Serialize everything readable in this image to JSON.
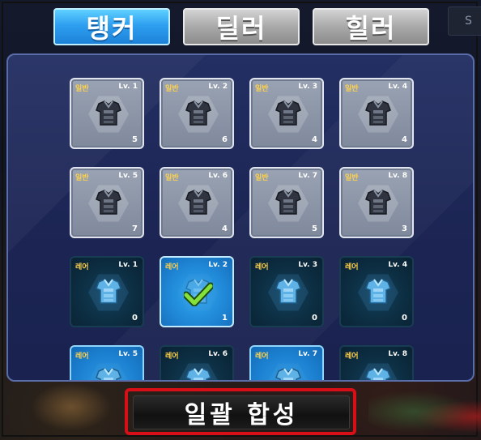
{
  "tabs": [
    {
      "label": "탱커",
      "active": true
    },
    {
      "label": "딜러",
      "active": false
    },
    {
      "label": "힐러",
      "active": false
    }
  ],
  "corner_label": "S",
  "colors": {
    "active_tab": "#2e9ff0",
    "inactive_tab": "#a9a9a9",
    "grade_text": "#ffd24a",
    "highlight_border": "#d80f16"
  },
  "cards": [
    {
      "grade": "일반",
      "level": "Lv. 1",
      "count": "5",
      "rarity": "common",
      "icon": "armor-icon"
    },
    {
      "grade": "일반",
      "level": "Lv. 2",
      "count": "6",
      "rarity": "common",
      "icon": "armor-icon"
    },
    {
      "grade": "일반",
      "level": "Lv. 3",
      "count": "4",
      "rarity": "common",
      "icon": "armor-icon"
    },
    {
      "grade": "일반",
      "level": "Lv. 4",
      "count": "4",
      "rarity": "common",
      "icon": "armor-icon"
    },
    {
      "grade": "일반",
      "level": "Lv. 5",
      "count": "7",
      "rarity": "common",
      "icon": "armor-icon"
    },
    {
      "grade": "일반",
      "level": "Lv. 6",
      "count": "4",
      "rarity": "common",
      "icon": "armor-icon"
    },
    {
      "grade": "일반",
      "level": "Lv. 7",
      "count": "5",
      "rarity": "common",
      "icon": "armor-icon"
    },
    {
      "grade": "일반",
      "level": "Lv. 8",
      "count": "3",
      "rarity": "common",
      "icon": "armor-icon"
    },
    {
      "grade": "레어",
      "level": "Lv. 1",
      "count": "0",
      "rarity": "rare",
      "icon": "armor-icon"
    },
    {
      "grade": "레어",
      "level": "Lv. 2",
      "count": "1",
      "rarity": "rare",
      "selected": true,
      "icon": "check-icon"
    },
    {
      "grade": "레어",
      "level": "Lv. 3",
      "count": "0",
      "rarity": "rare",
      "icon": "armor-icon"
    },
    {
      "grade": "레어",
      "level": "Lv. 4",
      "count": "0",
      "rarity": "rare",
      "icon": "armor-icon"
    },
    {
      "grade": "레어",
      "level": "Lv. 5",
      "count": "",
      "rarity": "rare-bright",
      "icon": "armor-icon"
    },
    {
      "grade": "레어",
      "level": "Lv. 6",
      "count": "",
      "rarity": "rare",
      "icon": "armor-icon"
    },
    {
      "grade": "레어",
      "level": "Lv. 7",
      "count": "",
      "rarity": "rare-bright",
      "icon": "armor-icon"
    },
    {
      "grade": "레어",
      "level": "Lv. 8",
      "count": "",
      "rarity": "rare",
      "icon": "armor-icon"
    }
  ],
  "combine_button": {
    "label": "일괄 합성"
  }
}
